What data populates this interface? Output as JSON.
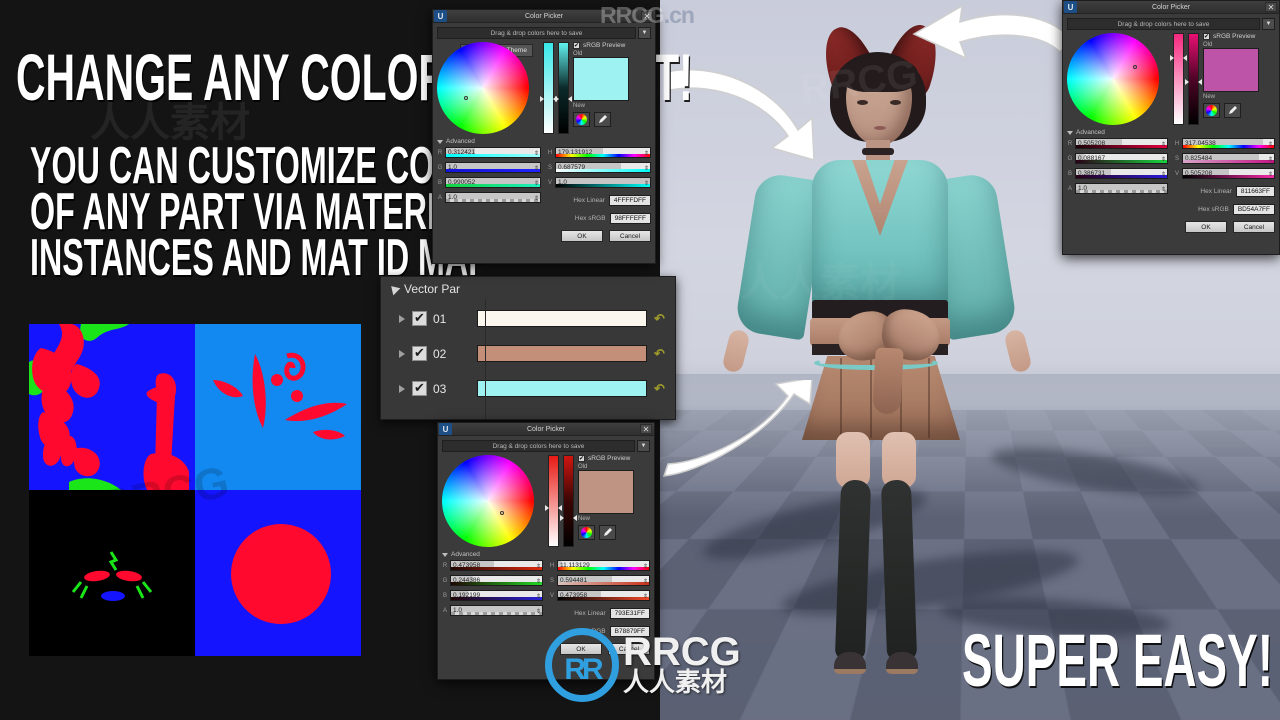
{
  "headline": {
    "main": "CHANGE ANY COLOR YOU WANT!",
    "sub_lines": [
      "YOU CAN CUSTOMIZE COLOR",
      "OF ANY PART VIA MATERIAL",
      "INSTANCES AND MAT ID MAP"
    ],
    "super": "SUPER EASY!"
  },
  "watermarks": {
    "top_right": "RRCG",
    "top_right_suffix": ".cn",
    "center_big": "RRCG",
    "center_cn": "人人素材",
    "ghost_left": "人人素材",
    "ghost_right": "RRCG"
  },
  "vector_panel": {
    "title": "Vector Par",
    "rows": [
      {
        "name": "01",
        "checked": true,
        "color": "#FBF7EE",
        "reset_icon": "undo-icon"
      },
      {
        "name": "02",
        "checked": true,
        "color": "#C38F79",
        "reset_icon": "undo-icon"
      },
      {
        "name": "03",
        "checked": true,
        "color": "#9EF2F2",
        "reset_icon": "undo-icon"
      }
    ]
  },
  "id_map": {
    "cells": [
      {
        "name": "body-mask",
        "base": "#1414FF"
      },
      {
        "name": "decal-mask",
        "base": "#1189F0"
      },
      {
        "name": "emissive-mask",
        "base": "#000000"
      },
      {
        "name": "accessory-mask",
        "base": "#1414FF"
      }
    ],
    "colors": {
      "red": "#FF0A2E",
      "green": "#19E519",
      "blue": "#1414FF",
      "cyan_blue": "#1189F0",
      "black": "#000000"
    }
  },
  "color_pickers": [
    {
      "id": "picker-cyan",
      "title": "Color Picker",
      "save_placeholder": "Drag & drop colors here to save",
      "tooltip": "Current Color Theme",
      "srgb_label": "sRGB Preview",
      "srgb_checked": true,
      "old_label": "Old",
      "new_label": "New",
      "advanced_label": "Advanced",
      "swatch_old": "#9EF2F2",
      "swatch_new": "#9EF2F2",
      "rgba": {
        "R": "0.312421",
        "G": "1.0",
        "B": "0.990052",
        "A": "1.0"
      },
      "hsv": {
        "H": "179.131912",
        "S": "0.687579",
        "V": "1.0"
      },
      "hex_linear_label": "Hex Linear",
      "hex_linear": "4FFFFDFF",
      "hex_srgb_label": "Hex sRGB",
      "hex_srgb": "98FFFEFF",
      "ok_label": "OK",
      "cancel_label": "Cancel"
    },
    {
      "id": "picker-magenta",
      "title": "Color Picker",
      "save_placeholder": "Drag & drop colors here to save",
      "srgb_label": "sRGB Preview",
      "srgb_checked": true,
      "old_label": "Old",
      "new_label": "New",
      "advanced_label": "Advanced",
      "swatch_old": "#BD54A7",
      "swatch_new": "#BD54A7",
      "rgba": {
        "R": "0.505208",
        "G": "0.088167",
        "B": "0.386731",
        "A": "1.0"
      },
      "hsv": {
        "H": "317.04538",
        "S": "0.825484",
        "V": "0.505208"
      },
      "hex_linear_label": "Hex Linear",
      "hex_linear": "811663FF",
      "hex_srgb_label": "Hex sRGB",
      "hex_srgb": "BD54A7FF",
      "ok_label": "OK",
      "cancel_label": "Cancel"
    },
    {
      "id": "picker-tan",
      "title": "Color Picker",
      "save_placeholder": "Drag & drop colors here to save",
      "srgb_label": "sRGB Preview",
      "srgb_checked": true,
      "old_label": "Old",
      "new_label": "New",
      "advanced_label": "Advanced",
      "swatch_old": "#C09482",
      "swatch_new": "#C09482",
      "rgba": {
        "R": "0.473958",
        "G": "0.244386",
        "B": "0.192199",
        "A": "1.0"
      },
      "hsv": {
        "H": "11.113129",
        "S": "0.594481",
        "V": "0.473958"
      },
      "hex_linear_label": "Hex Linear",
      "hex_linear": "793E31FF",
      "hex_srgb_label": "Hex sRGB",
      "hex_srgb": "B78879FF",
      "ok_label": "OK",
      "cancel_label": "Cancel"
    }
  ],
  "theme": {
    "panel_bg": "#3b3b3b",
    "accent_cyan": "#9EF2F2",
    "accent_magenta": "#BD54A7",
    "accent_tan": "#C09482",
    "ue_blue": "#1d4f86"
  }
}
